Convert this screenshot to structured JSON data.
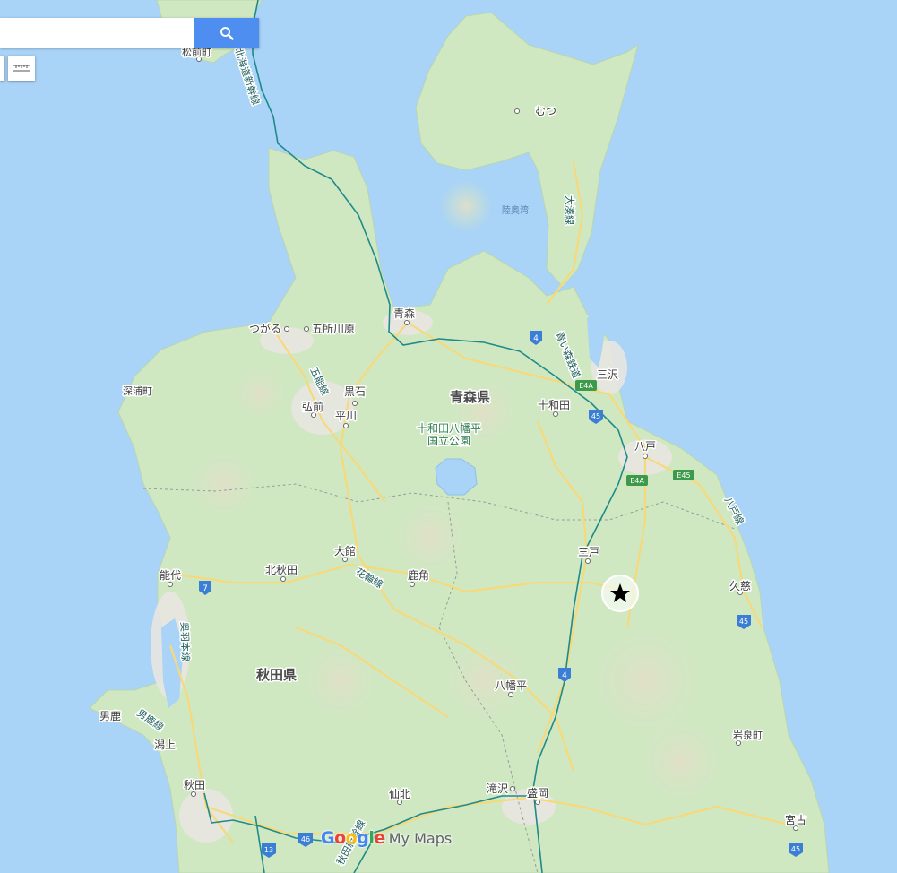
{
  "search": {
    "placeholder": "",
    "value": "",
    "icon": "search-icon"
  },
  "tools": {
    "ruler_icon": "ruler-icon"
  },
  "map": {
    "prefectures": [
      {
        "id": "aomori",
        "label": "青森県"
      },
      {
        "id": "akita",
        "label": "秋田県"
      }
    ],
    "park": {
      "line1": "十和田八幡平",
      "line2": "国立公園"
    },
    "sea": {
      "label": "陸奥湾"
    },
    "cities": [
      {
        "id": "matsumae",
        "label": "松前町"
      },
      {
        "id": "mutsu",
        "label": "むつ"
      },
      {
        "id": "aomori-city",
        "label": "青森"
      },
      {
        "id": "tsugaru",
        "label": "つがる"
      },
      {
        "id": "goshogawara",
        "label": "五所川原"
      },
      {
        "id": "fukaura",
        "label": "深浦町"
      },
      {
        "id": "kuroishi",
        "label": "黒石"
      },
      {
        "id": "hirosaki",
        "label": "弘前"
      },
      {
        "id": "hirakawa",
        "label": "平川"
      },
      {
        "id": "misawa",
        "label": "三沢"
      },
      {
        "id": "towada",
        "label": "十和田"
      },
      {
        "id": "hachinohe",
        "label": "八戸"
      },
      {
        "id": "sannohe",
        "label": "三戸"
      },
      {
        "id": "odate",
        "label": "大館"
      },
      {
        "id": "kitaakita",
        "label": "北秋田"
      },
      {
        "id": "noshiro",
        "label": "能代"
      },
      {
        "id": "kazuno",
        "label": "鹿角"
      },
      {
        "id": "kuji",
        "label": "久慈"
      },
      {
        "id": "hachimantai",
        "label": "八幡平"
      },
      {
        "id": "oga",
        "label": "男鹿"
      },
      {
        "id": "katagami",
        "label": "潟上"
      },
      {
        "id": "iwaizumi",
        "label": "岩泉町"
      },
      {
        "id": "akita-city",
        "label": "秋田"
      },
      {
        "id": "semboku",
        "label": "仙北"
      },
      {
        "id": "takizawa",
        "label": "滝沢"
      },
      {
        "id": "morioka",
        "label": "盛岡"
      },
      {
        "id": "miyako",
        "label": "宮古"
      }
    ],
    "rail_lines": [
      {
        "id": "hokkaido-shinkansen",
        "label": "北海道新幹線"
      },
      {
        "id": "ominato",
        "label": "大湊線"
      },
      {
        "id": "aoimori",
        "label": "青い森鉄道"
      },
      {
        "id": "gono",
        "label": "五能線"
      },
      {
        "id": "hanawa",
        "label": "花輪線"
      },
      {
        "id": "hachinohe-line",
        "label": "八戸線"
      },
      {
        "id": "ou",
        "label": "奥羽本線"
      },
      {
        "id": "oga-line",
        "label": "男鹿線"
      },
      {
        "id": "akita-shinkansen",
        "label": "秋田新幹線"
      }
    ],
    "road_shields": [
      {
        "id": "r4-north",
        "label": "4",
        "kind": "national"
      },
      {
        "id": "e4a-north",
        "label": "E4A",
        "kind": "expressway"
      },
      {
        "id": "r45-a",
        "label": "45",
        "kind": "national"
      },
      {
        "id": "e4a-south",
        "label": "E4A",
        "kind": "expressway"
      },
      {
        "id": "e45",
        "label": "E45",
        "kind": "expressway"
      },
      {
        "id": "r7",
        "label": "7",
        "kind": "national"
      },
      {
        "id": "r45-b",
        "label": "45",
        "kind": "national"
      },
      {
        "id": "r4-south",
        "label": "4",
        "kind": "national"
      },
      {
        "id": "r46",
        "label": "46",
        "kind": "national"
      },
      {
        "id": "r13",
        "label": "13",
        "kind": "national"
      },
      {
        "id": "r45-c",
        "label": "45",
        "kind": "national"
      }
    ],
    "marker": {
      "icon": "star-icon"
    },
    "colors": {
      "water": "#a9d3f7",
      "land": "#cfe8c2",
      "urban": "#e8e6e1",
      "rail": "#1e8a8a",
      "road": "#f7d97a",
      "shield_national": "#3a7fd5",
      "shield_expressway": "#3c9a4a"
    }
  },
  "attribution": {
    "google": [
      "G",
      "o",
      "o",
      "g",
      "l",
      "e"
    ],
    "google_colors": [
      "#4285f4",
      "#ea4335",
      "#fbbc05",
      "#4285f4",
      "#34a853",
      "#ea4335"
    ],
    "product": "My Maps"
  }
}
